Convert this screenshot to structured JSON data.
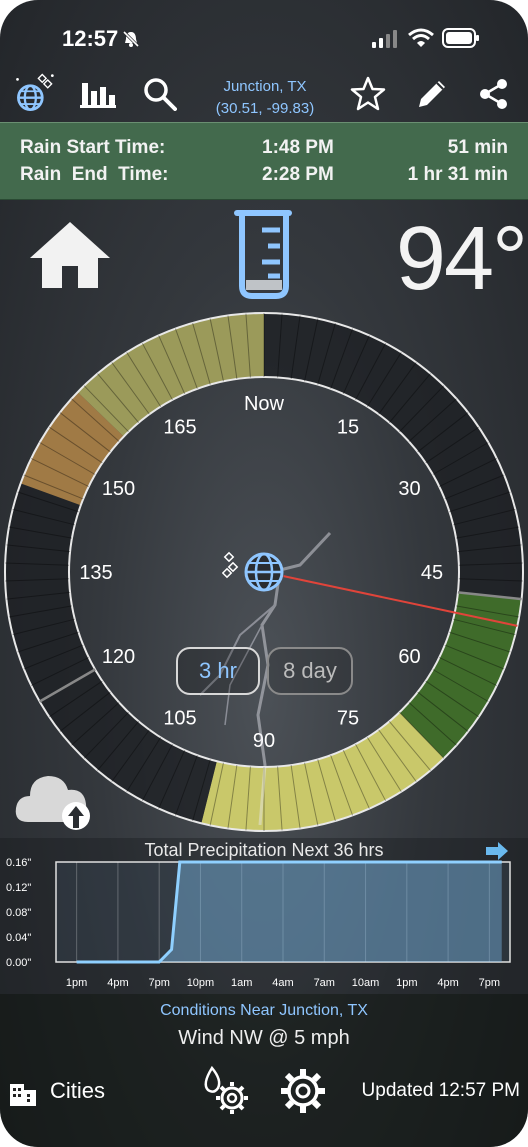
{
  "status_bar": {
    "time": "12:57"
  },
  "location": {
    "name": "Junction, TX",
    "coords": "(30.51, -99.83)"
  },
  "toolbar": {
    "icons": [
      "globe-satellite-icon",
      "bar-chart-icon",
      "search-icon",
      "star-icon",
      "pencil-icon",
      "share-icon"
    ]
  },
  "banner": {
    "start_label": "Rain Start Time:",
    "start_time": "1:48 PM",
    "start_in": "51 min",
    "end_label": "Rain  End  Time:",
    "end_time": "2:28 PM",
    "end_in": "1 hr 31 min"
  },
  "temperature": "94°",
  "dial": {
    "labels": [
      "Now",
      "15",
      "30",
      "45",
      "60",
      "75",
      "90",
      "105",
      "120",
      "135",
      "150",
      "165"
    ],
    "total_minutes": 180,
    "segments": [
      {
        "from": 0,
        "to": 48,
        "level": "none"
      },
      {
        "from": 48,
        "to": 68,
        "level": "moderate",
        "color": "#3f6b2a"
      },
      {
        "from": 68,
        "to": 97,
        "level": "light",
        "color": "#c9c86a"
      },
      {
        "from": 97,
        "to": 145,
        "level": "none"
      },
      {
        "from": 145,
        "to": 157,
        "level": "trace",
        "color": "#a07a45"
      },
      {
        "from": 157,
        "to": 180,
        "level": "light",
        "color": "#9b9a5a"
      }
    ],
    "current_minute": 51
  },
  "toggle": {
    "option_a": "3 hr",
    "option_b": "8 day",
    "selected": "3 hr"
  },
  "precip_chart": {
    "title": "Total Precipitation Next 36 hrs",
    "chart_data": {
      "type": "area",
      "x": [
        "1pm",
        "4pm",
        "7pm",
        "10pm",
        "1am",
        "4am",
        "7am",
        "10am",
        "1pm",
        "4pm",
        "7pm"
      ],
      "y_ticks": [
        "0.16\"",
        "0.12\"",
        "0.08\"",
        "0.04\"",
        "0.00\""
      ],
      "ylim": [
        0,
        0.16
      ],
      "series": [
        {
          "points": [
            [
              0,
              0
            ],
            [
              2,
              0
            ],
            [
              2.3,
              0.02
            ],
            [
              2.5,
              0.16
            ],
            [
              10.3,
              0.16
            ]
          ]
        }
      ]
    }
  },
  "conditions": {
    "title": "Conditions Near Junction, TX",
    "wind": "Wind NW @ 5 mph"
  },
  "bottom": {
    "cities": "Cities",
    "updated": "Updated 12:57 PM"
  }
}
